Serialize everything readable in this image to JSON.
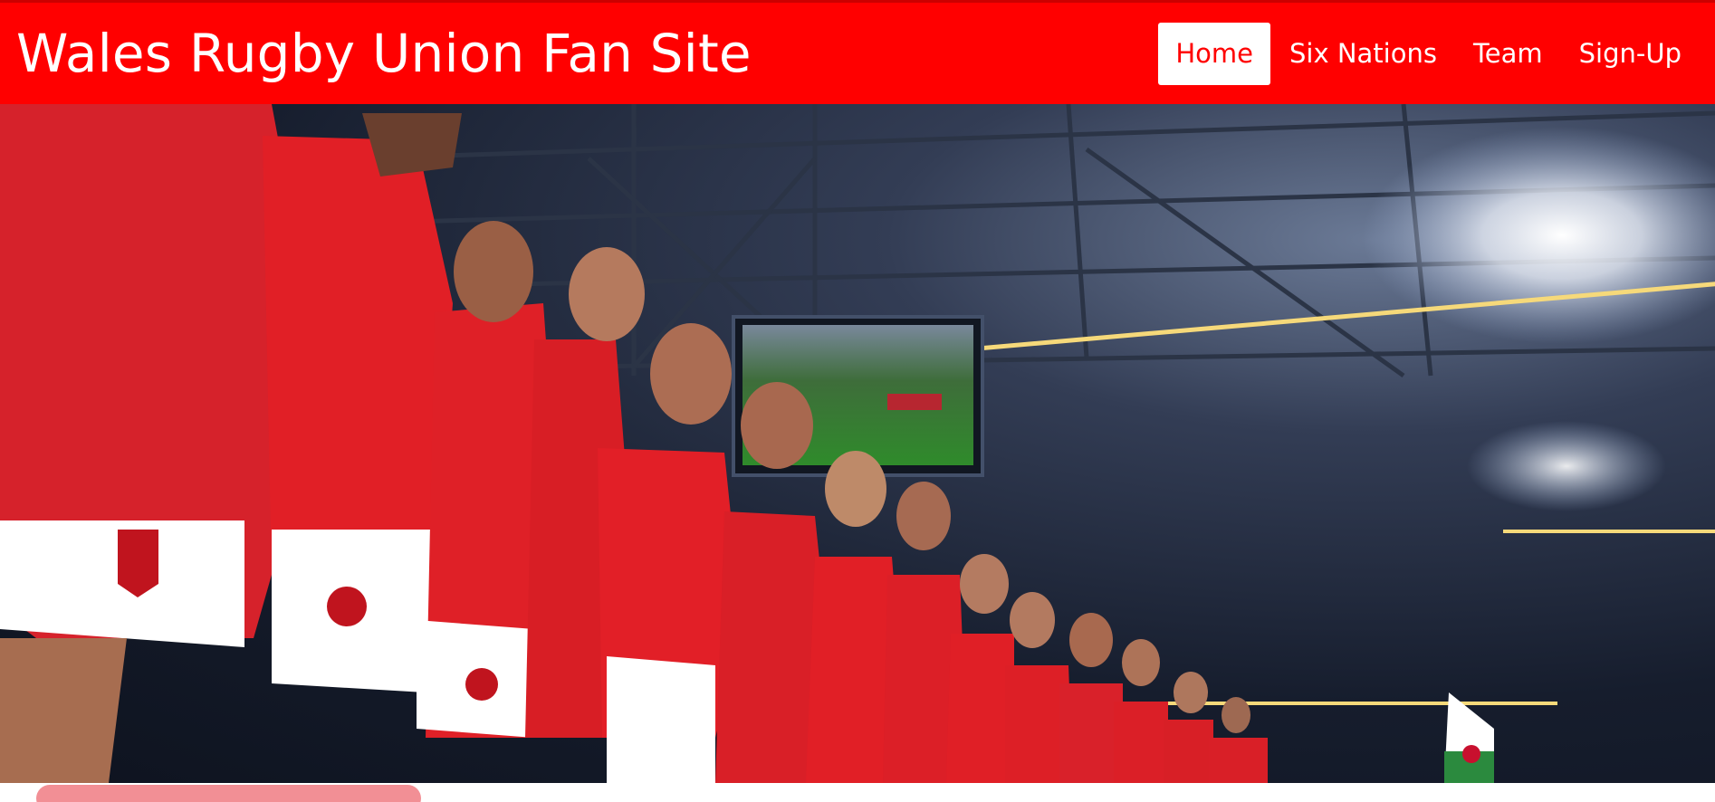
{
  "site": {
    "title": "Wales Rugby Union Fan Site"
  },
  "nav": {
    "items": [
      {
        "label": "Home",
        "active": true
      },
      {
        "label": "Six Nations",
        "active": false
      },
      {
        "label": "Team",
        "active": false
      },
      {
        "label": "Sign-Up",
        "active": false
      }
    ]
  },
  "colors": {
    "primary_red": "#ff0000",
    "below_pill": "#f28f95"
  }
}
